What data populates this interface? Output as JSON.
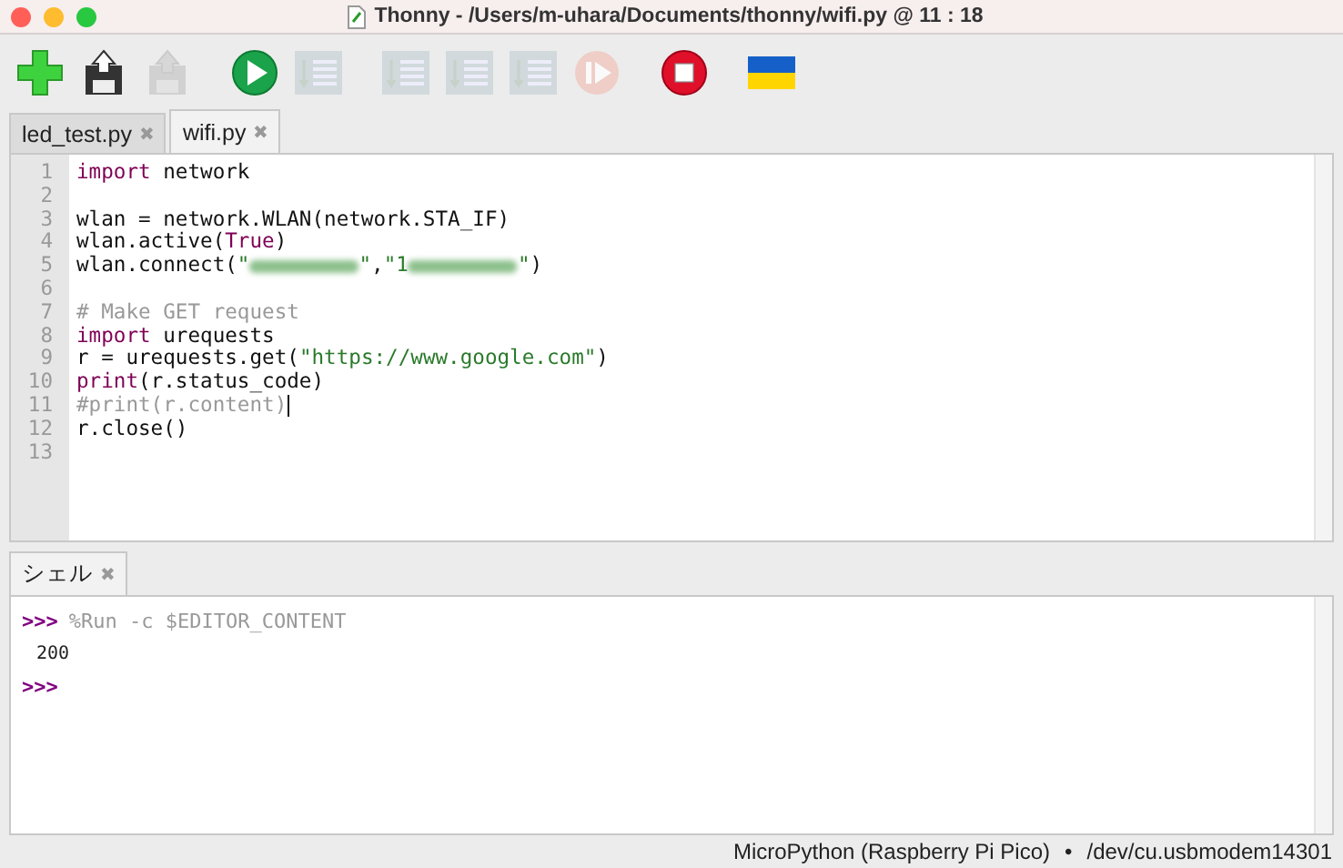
{
  "window": {
    "title": "Thonny  -  /Users/m-uhara/Documents/thonny/wifi.py  @  11 : 18"
  },
  "toolbar": [
    {
      "kind": "new",
      "disabled": false
    },
    {
      "kind": "save",
      "disabled": false
    },
    {
      "kind": "save",
      "disabled": true
    },
    {
      "kind": "run",
      "disabled": false
    },
    {
      "kind": "debug",
      "disabled": true
    },
    {
      "kind": "step-over",
      "disabled": true
    },
    {
      "kind": "step-into",
      "disabled": true
    },
    {
      "kind": "step-out",
      "disabled": true
    },
    {
      "kind": "resume",
      "disabled": true
    },
    {
      "kind": "stop",
      "disabled": false
    },
    {
      "kind": "flag",
      "disabled": false
    }
  ],
  "editor_tabs": [
    {
      "label": "led_test.py",
      "close": "✖",
      "selected": false
    },
    {
      "label": "wifi.py",
      "close": "✖",
      "selected": true
    }
  ],
  "code_lines": [
    {
      "number": "1",
      "cursor": false,
      "tokens": [
        {
          "kind": "keyword",
          "text": "import"
        },
        {
          "kind": "plain",
          "text": " network"
        }
      ]
    },
    {
      "number": "2",
      "cursor": false
    },
    {
      "number": "3",
      "cursor": false,
      "tokens": [
        {
          "kind": "plain",
          "text": "wlan = network.WLAN(network.STA_IF)"
        }
      ]
    },
    {
      "number": "4",
      "cursor": false,
      "tokens": [
        {
          "kind": "plain",
          "text": "wlan.active("
        },
        {
          "kind": "keyword",
          "text": "True"
        },
        {
          "kind": "plain",
          "text": ")"
        }
      ]
    },
    {
      "number": "5",
      "cursor": false,
      "tokens": [
        {
          "kind": "plain",
          "text": "wlan.connect("
        },
        {
          "kind": "string",
          "text": "\""
        },
        {
          "kind": "redacted"
        },
        {
          "kind": "string",
          "text": "\""
        },
        {
          "kind": "plain",
          "text": ","
        },
        {
          "kind": "string",
          "text": "\"1"
        },
        {
          "kind": "redacted"
        },
        {
          "kind": "string",
          "text": "\""
        },
        {
          "kind": "plain",
          "text": ")"
        }
      ]
    },
    {
      "number": "6",
      "cursor": false
    },
    {
      "number": "7",
      "cursor": false,
      "tokens": [
        {
          "kind": "comment",
          "text": "# Make GET request"
        }
      ]
    },
    {
      "number": "8",
      "cursor": false,
      "tokens": [
        {
          "kind": "keyword",
          "text": "import"
        },
        {
          "kind": "plain",
          "text": " urequests"
        }
      ]
    },
    {
      "number": "9",
      "cursor": false,
      "tokens": [
        {
          "kind": "plain",
          "text": "r = urequests.get("
        },
        {
          "kind": "string",
          "text": "\"https://www.google.com\""
        },
        {
          "kind": "plain",
          "text": ")"
        }
      ]
    },
    {
      "number": "10",
      "cursor": false,
      "tokens": [
        {
          "kind": "keyword",
          "text": "print"
        },
        {
          "kind": "plain",
          "text": "(r.status_code)"
        }
      ]
    },
    {
      "number": "11",
      "cursor": true,
      "tokens": [
        {
          "kind": "comment",
          "text": "#print(r.content)"
        }
      ]
    },
    {
      "number": "12",
      "cursor": false,
      "tokens": [
        {
          "kind": "plain",
          "text": "r.close()"
        }
      ]
    },
    {
      "number": "13",
      "cursor": false
    }
  ],
  "shell_tabs": [
    {
      "label": "シェル",
      "close": "✖",
      "selected": true
    }
  ],
  "shell_lines": [
    {
      "kind": "command",
      "prompt": ">>>",
      "text": "%Run -c $EDITOR_CONTENT"
    },
    {
      "kind": "output",
      "text": "200"
    },
    {
      "kind": "prompt",
      "prompt": ">>>"
    }
  ],
  "status_bar": {
    "interpreter": "MicroPython (Raspberry Pi Pico)",
    "separator": "•",
    "port": "/dev/cu.usbmodem14301"
  }
}
